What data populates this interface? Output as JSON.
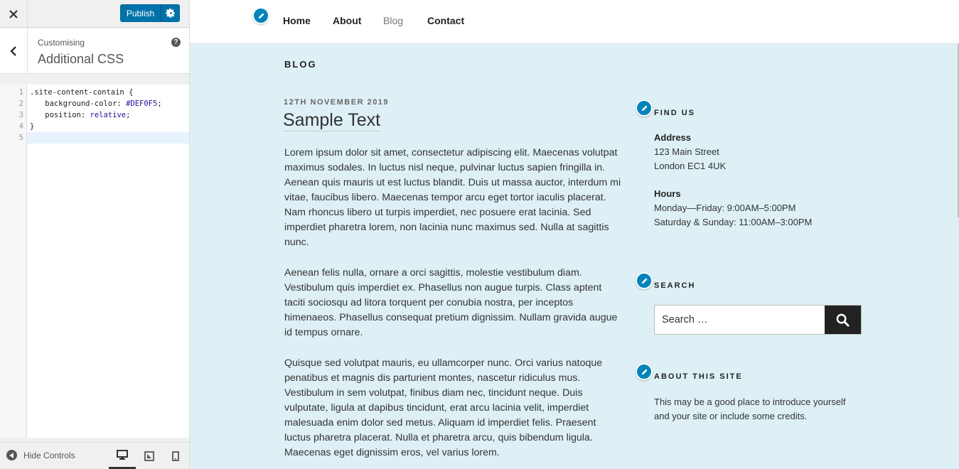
{
  "customizer": {
    "publish_label": "Publish",
    "breadcrumb": "Customising",
    "section_title": "Additional CSS",
    "help_label": "?",
    "code": {
      "line_numbers": [
        "1",
        "2",
        "3",
        "4",
        "5"
      ],
      "line1": ".site-content-contain {",
      "line2_prop": "    background-color: ",
      "line2_val": "#DEF0F5",
      "line2_end": ";",
      "line3_prop": "    position: ",
      "line3_val": "relative",
      "line3_end": ";",
      "line4": "}"
    },
    "footer": {
      "hide_controls_label": "Hide Controls"
    }
  },
  "site": {
    "nav": {
      "items": [
        {
          "label": "Home"
        },
        {
          "label": "About"
        },
        {
          "label": "Blog"
        },
        {
          "label": "Contact"
        }
      ],
      "current": "Blog"
    },
    "page_heading": "BLOG",
    "post": {
      "date": "12TH NOVEMBER 2019",
      "title": "Sample Text",
      "paragraphs": [
        "Lorem ipsum dolor sit amet, consectetur adipiscing elit. Maecenas volutpat maximus sodales. In luctus nisl neque, pulvinar luctus sapien fringilla in. Aenean quis mauris ut est luctus blandit. Duis ut massa auctor, interdum mi vitae, faucibus libero. Maecenas tempor arcu eget tortor iaculis placerat. Nam rhoncus libero ut turpis imperdiet, nec posuere erat lacinia. Sed imperdiet pharetra lorem, non lacinia nunc maximus sed. Nulla at sagittis nunc.",
        "Aenean felis nulla, ornare a orci sagittis, molestie vestibulum diam. Vestibulum quis imperdiet ex. Phasellus non augue turpis. Class aptent taciti sociosqu ad litora torquent per conubia nostra, per inceptos himenaeos. Phasellus consequat pretium dignissim. Nullam gravida augue id tempus ornare.",
        "Quisque sed volutpat mauris, eu ullamcorper nunc. Orci varius natoque penatibus et magnis dis parturient montes, nascetur ridiculus mus. Vestibulum in sem volutpat, finibus diam nec, tincidunt neque. Duis vulputate, ligula at dapibus tincidunt, erat arcu lacinia velit, imperdiet malesuada enim dolor sed metus. Aliquam id imperdiet felis. Praesent luctus pharetra placerat. Nulla et pharetra arcu, quis bibendum ligula. Maecenas eget dignissim eros, vel varius lorem."
      ]
    },
    "sidebar": {
      "find_us": {
        "title": "FIND US",
        "address_label": "Address",
        "address_line1": "123 Main Street",
        "address_line2": "London EC1 4UK",
        "hours_label": "Hours",
        "hours_line1": "Monday—Friday: 9:00AM–5:00PM",
        "hours_line2": "Saturday & Sunday: 11:00AM–3:00PM"
      },
      "search": {
        "title": "SEARCH",
        "placeholder": "Search …"
      },
      "about": {
        "title": "ABOUT THIS SITE",
        "line1": "This may be a good place to introduce yourself",
        "line2": "and your site or include some credits."
      }
    }
  },
  "colors": {
    "accent": "#0073aa",
    "preview_background": "#def0f5",
    "shortcut": "#0085ba"
  }
}
